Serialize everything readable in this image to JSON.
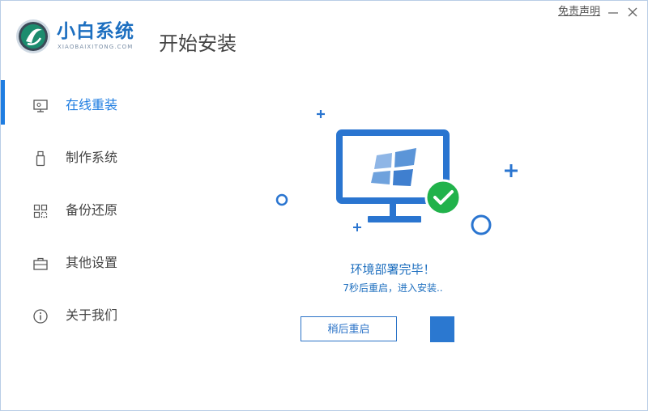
{
  "app": {
    "brand_name": "小白系统",
    "brand_sub": "XIAOBAIXITONG.COM",
    "page_title": "开始安装"
  },
  "window": {
    "disclaimer": "免责声明"
  },
  "sidebar": {
    "items": [
      {
        "label": "在线重装",
        "icon": "monitor-icon",
        "active": true
      },
      {
        "label": "制作系统",
        "icon": "usb-drive-icon",
        "active": false
      },
      {
        "label": "备份还原",
        "icon": "backup-grid-icon",
        "active": false
      },
      {
        "label": "其他设置",
        "icon": "toolbox-icon",
        "active": false
      },
      {
        "label": "关于我们",
        "icon": "info-icon",
        "active": false
      }
    ]
  },
  "main": {
    "status_title": "环境部署完毕！",
    "status_sub": "7秒后重启，进入安装..",
    "restart_label": "稍后重启"
  },
  "colors": {
    "accent": "#1f7de1",
    "success": "#21b24b",
    "monitor": "#2a75d0"
  }
}
